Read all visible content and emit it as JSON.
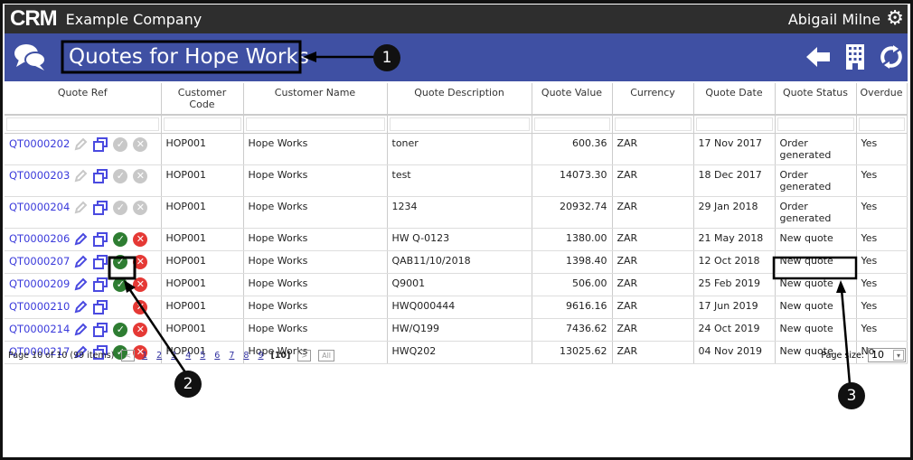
{
  "topbar": {
    "logo": "CRM",
    "company": "Example Company",
    "user": "Abigail Milne"
  },
  "page": {
    "title": "Quotes for Hope Works"
  },
  "table": {
    "headers": [
      "Quote Ref",
      "Customer Code",
      "Customer Name",
      "Quote Description",
      "Quote Value",
      "Currency",
      "Quote Date",
      "Quote Status",
      "Overdue"
    ],
    "rows": [
      {
        "ref": "QT0000202",
        "code": "HOP001",
        "name": "Hope Works",
        "desc": "toner",
        "value": "600.36",
        "cur": "ZAR",
        "date": "17 Nov 2017",
        "status": "Order generated",
        "overdue": "Yes",
        "editable": false,
        "check": true
      },
      {
        "ref": "QT0000203",
        "code": "HOP001",
        "name": "Hope Works",
        "desc": "test",
        "value": "14073.30",
        "cur": "ZAR",
        "date": "18 Dec 2017",
        "status": "Order generated",
        "overdue": "Yes",
        "editable": false,
        "check": true
      },
      {
        "ref": "QT0000204",
        "code": "HOP001",
        "name": "Hope Works",
        "desc": "1234",
        "value": "20932.74",
        "cur": "ZAR",
        "date": "29 Jan 2018",
        "status": "Order generated",
        "overdue": "Yes",
        "editable": false,
        "check": true
      },
      {
        "ref": "QT0000206",
        "code": "HOP001",
        "name": "Hope Works",
        "desc": "HW Q-0123",
        "value": "1380.00",
        "cur": "ZAR",
        "date": "21 May 2018",
        "status": "New quote",
        "overdue": "Yes",
        "editable": true,
        "check": true
      },
      {
        "ref": "QT0000207",
        "code": "HOP001",
        "name": "Hope Works",
        "desc": "QAB11/10/2018",
        "value": "1398.40",
        "cur": "ZAR",
        "date": "12 Oct 2018",
        "status": "New quote",
        "overdue": "Yes",
        "editable": true,
        "check": true
      },
      {
        "ref": "QT0000209",
        "code": "HOP001",
        "name": "Hope Works",
        "desc": "Q9001",
        "value": "506.00",
        "cur": "ZAR",
        "date": "25 Feb 2019",
        "status": "New quote",
        "overdue": "Yes",
        "editable": true,
        "check": true
      },
      {
        "ref": "QT0000210",
        "code": "HOP001",
        "name": "Hope Works",
        "desc": "HWQ000444",
        "value": "9616.16",
        "cur": "ZAR",
        "date": "17 Jun 2019",
        "status": "New quote",
        "overdue": "Yes",
        "editable": true,
        "check": false
      },
      {
        "ref": "QT0000214",
        "code": "HOP001",
        "name": "Hope Works",
        "desc": "HW/Q199",
        "value": "7436.62",
        "cur": "ZAR",
        "date": "24 Oct 2019",
        "status": "New quote",
        "overdue": "Yes",
        "editable": true,
        "check": true
      },
      {
        "ref": "QT0000217",
        "code": "HOP001",
        "name": "Hope Works",
        "desc": "HWQ202",
        "value": "13025.62",
        "cur": "ZAR",
        "date": "04 Nov 2019",
        "status": "New quote",
        "overdue": "No",
        "editable": true,
        "check": true
      }
    ]
  },
  "pager": {
    "summary": "Page 10 of 10 (99 items)",
    "pages": [
      "1",
      "2",
      "3",
      "4",
      "5",
      "6",
      "7",
      "8",
      "9"
    ],
    "current": "[10]",
    "prev": "<",
    "next": ">",
    "all": "All",
    "page_size_label": "Page size:",
    "page_size": "10"
  },
  "annotations": [
    "1",
    "2",
    "3"
  ],
  "colors": {
    "topbar": "#2e2e2e",
    "band": "#3f50a3",
    "link": "#3b3bdb",
    "check": "#2e7d32",
    "cancel": "#e53935"
  }
}
